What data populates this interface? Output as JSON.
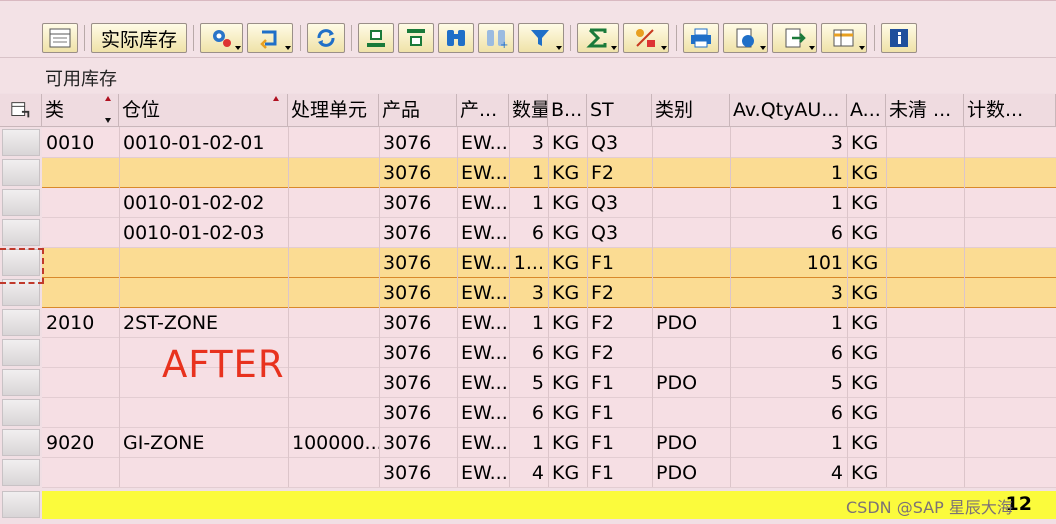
{
  "toolbar": {
    "stock_button_label": "实际库存",
    "icons": [
      "layout-icon",
      "settings-icon",
      "undo-icon",
      "refresh-icon",
      "align-top-icon",
      "align-bottom-icon",
      "binoculars-icon",
      "binoculars-plus-icon",
      "filter-icon",
      "sum-icon",
      "percent-icon",
      "print-icon",
      "export-icon",
      "import-icon",
      "table-layout-icon",
      "info-icon"
    ]
  },
  "view_title": "可用库存",
  "table": {
    "columns": [
      "类",
      "仓位",
      "处理单元",
      "产品",
      "产...",
      "数量",
      "B...",
      "ST",
      "类别",
      "Av.QtyAU...",
      "A...",
      "未清 ...",
      "计数..."
    ],
    "rows": [
      {
        "c0": "0010",
        "c1": "0010-01-02-01",
        "c2": "",
        "c3": "3076",
        "c4": "EW...",
        "c5": "3",
        "c6": "KG",
        "c7": "Q3",
        "c8": "",
        "c9": "3",
        "c10": "KG",
        "c11": "",
        "c12": ""
      },
      {
        "c0": "",
        "c1": "",
        "c2": "",
        "c3": "3076",
        "c4": "EW...",
        "c5": "1",
        "c6": "KG",
        "c7": "F2",
        "c8": "",
        "c9": "1",
        "c10": "KG",
        "c11": "",
        "c12": ""
      },
      {
        "c0": "",
        "c1": "0010-01-02-02",
        "c2": "",
        "c3": "3076",
        "c4": "EW...",
        "c5": "1",
        "c6": "KG",
        "c7": "Q3",
        "c8": "",
        "c9": "1",
        "c10": "KG",
        "c11": "",
        "c12": ""
      },
      {
        "c0": "",
        "c1": "0010-01-02-03",
        "c2": "",
        "c3": "3076",
        "c4": "EW...",
        "c5": "6",
        "c6": "KG",
        "c7": "Q3",
        "c8": "",
        "c9": "6",
        "c10": "KG",
        "c11": "",
        "c12": ""
      },
      {
        "c0": "",
        "c1": "",
        "c2": "",
        "c3": "3076",
        "c4": "EW...",
        "c5": "1...",
        "c6": "KG",
        "c7": "F1",
        "c8": "",
        "c9": "101",
        "c10": "KG",
        "c11": "",
        "c12": ""
      },
      {
        "c0": "",
        "c1": "",
        "c2": "",
        "c3": "3076",
        "c4": "EW...",
        "c5": "3",
        "c6": "KG",
        "c7": "F2",
        "c8": "",
        "c9": "3",
        "c10": "KG",
        "c11": "",
        "c12": ""
      },
      {
        "c0": "2010",
        "c1": "2ST-ZONE",
        "c2": "",
        "c3": "3076",
        "c4": "EW...",
        "c5": "1",
        "c6": "KG",
        "c7": "F2",
        "c8": "PDO",
        "c9": "1",
        "c10": "KG",
        "c11": "",
        "c12": ""
      },
      {
        "c0": "",
        "c1": "",
        "c2": "",
        "c3": "3076",
        "c4": "EW...",
        "c5": "6",
        "c6": "KG",
        "c7": "F2",
        "c8": "",
        "c9": "6",
        "c10": "KG",
        "c11": "",
        "c12": ""
      },
      {
        "c0": "",
        "c1": "",
        "c2": "",
        "c3": "3076",
        "c4": "EW...",
        "c5": "5",
        "c6": "KG",
        "c7": "F1",
        "c8": "PDO",
        "c9": "5",
        "c10": "KG",
        "c11": "",
        "c12": ""
      },
      {
        "c0": "",
        "c1": "",
        "c2": "",
        "c3": "3076",
        "c4": "EW...",
        "c5": "6",
        "c6": "KG",
        "c7": "F1",
        "c8": "",
        "c9": "6",
        "c10": "KG",
        "c11": "",
        "c12": ""
      },
      {
        "c0": "9020",
        "c1": "GI-ZONE",
        "c2": "100000...",
        "c3": "3076",
        "c4": "EW...",
        "c5": "1",
        "c6": "KG",
        "c7": "F1",
        "c8": "PDO",
        "c9": "1",
        "c10": "KG",
        "c11": "",
        "c12": ""
      },
      {
        "c0": "",
        "c1": "",
        "c2": "",
        "c3": "3076",
        "c4": "EW...",
        "c5": "4",
        "c6": "KG",
        "c7": "F1",
        "c8": "PDO",
        "c9": "4",
        "c10": "KG",
        "c11": "",
        "c12": ""
      }
    ],
    "highlighted_rows": [
      1,
      4,
      5
    ],
    "total_count": "12"
  },
  "annotation": "AFTER",
  "watermark": "CSDN @SAP 星辰大海",
  "colors": {
    "row_bg": "#f6dfe4",
    "highlight_bg": "#fbdc93",
    "total_bg": "#fbfb3c",
    "annotation": "#e8321e",
    "selected_marker": "#c0392b"
  }
}
